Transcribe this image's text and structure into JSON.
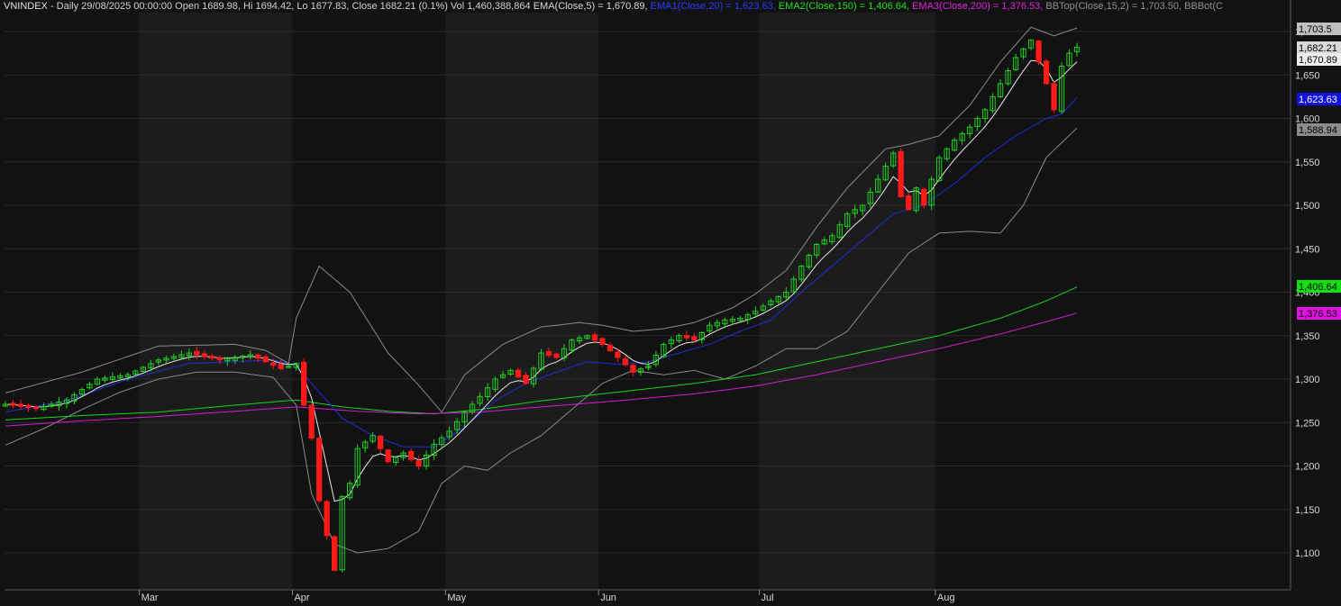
{
  "header": {
    "symbol": "VNINDEX",
    "info": " - Daily 29/08/2025 00:00:00 Open 1689.98, Hi 1694.42, Lo 1677.83, Close 1682.21 (0.1%) Vol 1,460,388,864 ",
    "ema5": "EMA(Close,5) = 1,670.89,",
    "ema1": " EMA1(Close,20) = 1,623.63,",
    "ema2": " EMA2(Close,150) = 1,406.64,",
    "ema3": " EMA3(Close,200) = 1,376.53,",
    "bbtop": " BBTop(Close,15,2) = 1,703.50,",
    "bbbot": " BBBot(C"
  },
  "colors": {
    "background": "#121212",
    "band": "#1c1c1c",
    "up": "#1fd11f",
    "down": "#ff1a1a",
    "ema5": "#e8e8e8",
    "ema20": "#1c2fd8",
    "ema150": "#19d419",
    "ema200": "#d41ad4",
    "bb": "#8a8a8a"
  },
  "value_tags": [
    {
      "text": "1,703.5",
      "value": 1703.5,
      "bg": "#bfbfbf",
      "fg": "#000000"
    },
    {
      "text": "1,682.21",
      "value": 1682.21,
      "bg": "#d8d8d8",
      "fg": "#000000"
    },
    {
      "text": "1,670.89",
      "value": 1670.89,
      "bg": "#eeeeee",
      "fg": "#000000"
    },
    {
      "text": "1,623.63",
      "value": 1623.63,
      "bg": "#1010e0",
      "fg": "#ffffff"
    },
    {
      "text": "1,588.94",
      "value": 1588.94,
      "bg": "#8c8c8c",
      "fg": "#000000"
    },
    {
      "text": "1,406.64",
      "value": 1406.64,
      "bg": "#10e010",
      "fg": "#000000"
    },
    {
      "text": "1,376.53",
      "value": 1376.53,
      "bg": "#e010e0",
      "fg": "#000000"
    }
  ],
  "chart_data": {
    "type": "candlestick",
    "y_ticks": [
      1100,
      1150,
      1200,
      1250,
      1300,
      1350,
      1400,
      1450,
      1500,
      1550,
      1600,
      1650,
      1700
    ],
    "y_tick_labels": [
      "1,100",
      "1,150",
      "1,200",
      "1,250",
      "1,300",
      "1,350",
      "1,400",
      "1,450",
      "1,500",
      "1,550",
      "1,600",
      "1,650",
      "1,700"
    ],
    "ylim": [
      1058,
      1720
    ],
    "bar_count": 141,
    "month_labels": [
      {
        "label": "Mar",
        "bar": 17.5
      },
      {
        "label": "Apr",
        "bar": 37.5
      },
      {
        "label": "May",
        "bar": 57.5
      },
      {
        "label": "Jun",
        "bar": 77.5
      },
      {
        "label": "Jul",
        "bar": 98.5
      },
      {
        "label": "Aug",
        "bar": 121.5
      }
    ],
    "shaded_months": [
      [
        17.5,
        37.5
      ],
      [
        57.5,
        77.5
      ],
      [
        98.5,
        121.5
      ]
    ],
    "candles_anchor": [
      [
        0,
        1271
      ],
      [
        4,
        1266
      ],
      [
        8,
        1276
      ],
      [
        12,
        1300
      ],
      [
        16,
        1305
      ],
      [
        20,
        1322
      ],
      [
        24,
        1330
      ],
      [
        28,
        1322
      ],
      [
        32,
        1328
      ],
      [
        36,
        1312
      ],
      [
        38,
        1318
      ],
      [
        39,
        1270
      ],
      [
        40,
        1232
      ],
      [
        41,
        1160
      ],
      [
        42,
        1120
      ],
      [
        43,
        1080
      ],
      [
        44,
        1165
      ],
      [
        45,
        1180
      ],
      [
        46,
        1220
      ],
      [
        48,
        1235
      ],
      [
        50,
        1205
      ],
      [
        52,
        1215
      ],
      [
        54,
        1200
      ],
      [
        56,
        1225
      ],
      [
        58,
        1240
      ],
      [
        60,
        1262
      ],
      [
        62,
        1280
      ],
      [
        64,
        1300
      ],
      [
        66,
        1310
      ],
      [
        68,
        1295
      ],
      [
        70,
        1330
      ],
      [
        72,
        1325
      ],
      [
        74,
        1345
      ],
      [
        76,
        1350
      ],
      [
        78,
        1340
      ],
      [
        80,
        1325
      ],
      [
        82,
        1308
      ],
      [
        84,
        1315
      ],
      [
        86,
        1340
      ],
      [
        88,
        1350
      ],
      [
        90,
        1345
      ],
      [
        92,
        1362
      ],
      [
        94,
        1368
      ],
      [
        96,
        1370
      ],
      [
        98,
        1378
      ],
      [
        100,
        1390
      ],
      [
        102,
        1400
      ],
      [
        104,
        1430
      ],
      [
        106,
        1455
      ],
      [
        108,
        1465
      ],
      [
        110,
        1490
      ],
      [
        112,
        1500
      ],
      [
        114,
        1530
      ],
      [
        116,
        1560
      ],
      [
        117,
        1510
      ],
      [
        118,
        1495
      ],
      [
        119,
        1520
      ],
      [
        120,
        1500
      ],
      [
        121,
        1530
      ],
      [
        122,
        1555
      ],
      [
        124,
        1575
      ],
      [
        126,
        1590
      ],
      [
        128,
        1610
      ],
      [
        130,
        1640
      ],
      [
        132,
        1670
      ],
      [
        133,
        1680
      ],
      [
        134,
        1690
      ],
      [
        135,
        1665
      ],
      [
        136,
        1640
      ],
      [
        137,
        1610
      ],
      [
        138,
        1660
      ],
      [
        139,
        1675
      ],
      [
        140,
        1682
      ]
    ],
    "bb_top_anchor": [
      [
        0,
        1284
      ],
      [
        10,
        1308
      ],
      [
        20,
        1338
      ],
      [
        30,
        1340
      ],
      [
        34,
        1333
      ],
      [
        37,
        1318
      ],
      [
        38,
        1370
      ],
      [
        41,
        1430
      ],
      [
        45,
        1400
      ],
      [
        50,
        1330
      ],
      [
        54,
        1293
      ],
      [
        57,
        1262
      ],
      [
        60,
        1305
      ],
      [
        65,
        1340
      ],
      [
        70,
        1360
      ],
      [
        75,
        1365
      ],
      [
        78,
        1362
      ],
      [
        82,
        1355
      ],
      [
        86,
        1358
      ],
      [
        90,
        1365
      ],
      [
        95,
        1382
      ],
      [
        98,
        1398
      ],
      [
        102,
        1425
      ],
      [
        106,
        1475
      ],
      [
        110,
        1520
      ],
      [
        115,
        1565
      ],
      [
        118,
        1570
      ],
      [
        122,
        1580
      ],
      [
        126,
        1615
      ],
      [
        130,
        1665
      ],
      [
        134,
        1705
      ],
      [
        137,
        1695
      ],
      [
        140,
        1704
      ]
    ],
    "bb_bot_anchor": [
      [
        0,
        1224
      ],
      [
        5,
        1243
      ],
      [
        10,
        1265
      ],
      [
        15,
        1285
      ],
      [
        20,
        1300
      ],
      [
        25,
        1308
      ],
      [
        30,
        1308
      ],
      [
        35,
        1302
      ],
      [
        38,
        1270
      ],
      [
        40,
        1168
      ],
      [
        43,
        1110
      ],
      [
        46,
        1100
      ],
      [
        50,
        1105
      ],
      [
        54,
        1125
      ],
      [
        57,
        1180
      ],
      [
        60,
        1200
      ],
      [
        63,
        1195
      ],
      [
        66,
        1215
      ],
      [
        70,
        1235
      ],
      [
        74,
        1265
      ],
      [
        78,
        1295
      ],
      [
        82,
        1310
      ],
      [
        86,
        1305
      ],
      [
        90,
        1310
      ],
      [
        94,
        1300
      ],
      [
        98,
        1315
      ],
      [
        102,
        1335
      ],
      [
        106,
        1335
      ],
      [
        110,
        1355
      ],
      [
        114,
        1400
      ],
      [
        118,
        1445
      ],
      [
        122,
        1468
      ],
      [
        126,
        1470
      ],
      [
        130,
        1468
      ],
      [
        133,
        1500
      ],
      [
        136,
        1555
      ],
      [
        140,
        1589
      ]
    ],
    "ema20_anchor": [
      [
        0,
        1262
      ],
      [
        8,
        1275
      ],
      [
        16,
        1300
      ],
      [
        24,
        1318
      ],
      [
        30,
        1320
      ],
      [
        35,
        1322
      ],
      [
        38,
        1315
      ],
      [
        41,
        1285
      ],
      [
        44,
        1255
      ],
      [
        48,
        1235
      ],
      [
        52,
        1222
      ],
      [
        56,
        1222
      ],
      [
        60,
        1245
      ],
      [
        64,
        1275
      ],
      [
        68,
        1295
      ],
      [
        72,
        1308
      ],
      [
        76,
        1320
      ],
      [
        80,
        1317
      ],
      [
        84,
        1320
      ],
      [
        88,
        1330
      ],
      [
        92,
        1340
      ],
      [
        96,
        1355
      ],
      [
        100,
        1368
      ],
      [
        104,
        1400
      ],
      [
        108,
        1430
      ],
      [
        112,
        1460
      ],
      [
        116,
        1490
      ],
      [
        120,
        1500
      ],
      [
        124,
        1525
      ],
      [
        128,
        1555
      ],
      [
        132,
        1580
      ],
      [
        136,
        1600
      ],
      [
        138,
        1605
      ],
      [
        140,
        1624
      ]
    ],
    "ema150_anchor": [
      [
        0,
        1253
      ],
      [
        10,
        1258
      ],
      [
        20,
        1262
      ],
      [
        30,
        1270
      ],
      [
        38,
        1276
      ],
      [
        44,
        1268
      ],
      [
        50,
        1263
      ],
      [
        56,
        1260
      ],
      [
        62,
        1265
      ],
      [
        70,
        1275
      ],
      [
        80,
        1285
      ],
      [
        90,
        1295
      ],
      [
        98,
        1305
      ],
      [
        106,
        1320
      ],
      [
        114,
        1335
      ],
      [
        122,
        1350
      ],
      [
        130,
        1370
      ],
      [
        136,
        1390
      ],
      [
        140,
        1406
      ]
    ],
    "ema200_anchor": [
      [
        0,
        1246
      ],
      [
        10,
        1252
      ],
      [
        20,
        1257
      ],
      [
        30,
        1263
      ],
      [
        38,
        1268
      ],
      [
        46,
        1263
      ],
      [
        54,
        1260
      ],
      [
        62,
        1262
      ],
      [
        70,
        1268
      ],
      [
        80,
        1275
      ],
      [
        90,
        1283
      ],
      [
        98,
        1292
      ],
      [
        106,
        1305
      ],
      [
        114,
        1320
      ],
      [
        122,
        1335
      ],
      [
        130,
        1352
      ],
      [
        136,
        1366
      ],
      [
        140,
        1376
      ]
    ]
  }
}
